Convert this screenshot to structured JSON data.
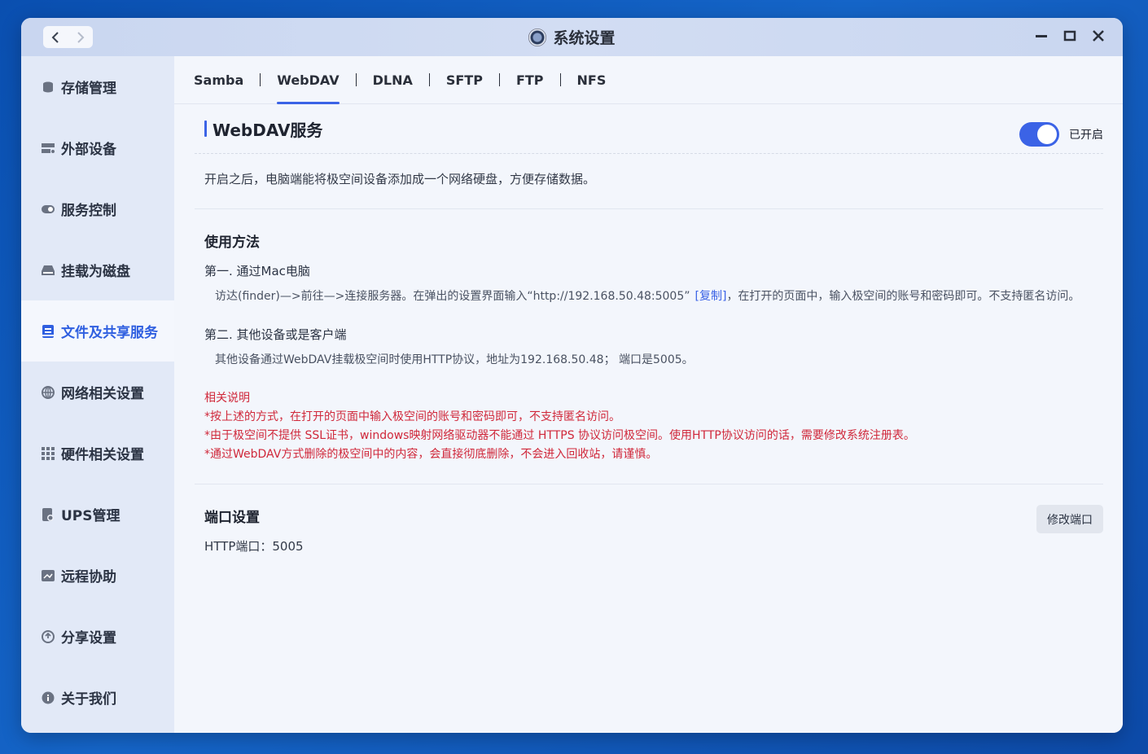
{
  "window": {
    "title": "系统设置"
  },
  "sidebar": {
    "items": [
      {
        "label": "存储管理",
        "icon": "database-icon",
        "active": false
      },
      {
        "label": "外部设备",
        "icon": "external-device-icon",
        "active": false
      },
      {
        "label": "服务控制",
        "icon": "toggle-icon",
        "active": false
      },
      {
        "label": "挂载为磁盘",
        "icon": "drive-icon",
        "active": false
      },
      {
        "label": "文件及共享服务",
        "icon": "file-share-icon",
        "active": true
      },
      {
        "label": "网络相关设置",
        "icon": "globe-icon",
        "active": false
      },
      {
        "label": "硬件相关设置",
        "icon": "grid-icon",
        "active": false
      },
      {
        "label": "UPS管理",
        "icon": "ups-icon",
        "active": false
      },
      {
        "label": "远程协助",
        "icon": "remote-icon",
        "active": false
      },
      {
        "label": "分享设置",
        "icon": "share-icon",
        "active": false
      },
      {
        "label": "关于我们",
        "icon": "info-icon",
        "active": false
      }
    ]
  },
  "tabs": [
    {
      "label": "Samba",
      "active": false
    },
    {
      "label": "WebDAV",
      "active": true
    },
    {
      "label": "DLNA",
      "active": false
    },
    {
      "label": "SFTP",
      "active": false
    },
    {
      "label": "FTP",
      "active": false
    },
    {
      "label": "NFS",
      "active": false
    }
  ],
  "service": {
    "title": "WebDAV服务",
    "toggle_state": "on",
    "toggle_label": "已开启",
    "description": "开启之后，电脑端能将极空间设备添加成一个网络硬盘，方便存储数据。"
  },
  "usage": {
    "heading": "使用方法",
    "step1_title": "第一. 通过Mac电脑",
    "step1_text_a": "访达(finder)—>前往—>连接服务器。在弹出的设置界面输入“http://192.168.50.48:5005”",
    "step1_copy": "[复制]",
    "step1_text_b": "，在打开的页面中，输入极空间的账号和密码即可。不支持匿名访问。",
    "step2_title": "第二. 其他设备或是客户端",
    "step2_text": "其他设备通过WebDAV挂载极空间时使用HTTP协议，地址为192.168.50.48； 端口是5005。",
    "notes": [
      "相关说明",
      "*按上述的方式，在打开的页面中输入极空间的账号和密码即可，不支持匿名访问。",
      "*由于极空间不提供 SSL证书，windows映射网络驱动器不能通过 HTTPS 协议访问极空间。使用HTTP协议访问的话，需要修改系统注册表。",
      "*通过WebDAV方式删除的极空间中的内容，会直接彻底删除，不会进入回收站，请谨慎。"
    ]
  },
  "port": {
    "heading": "端口设置",
    "line": "HTTP端口：5005",
    "button": "修改端口"
  },
  "colors": {
    "accent": "#3b63e6",
    "warning": "#d0283a"
  }
}
